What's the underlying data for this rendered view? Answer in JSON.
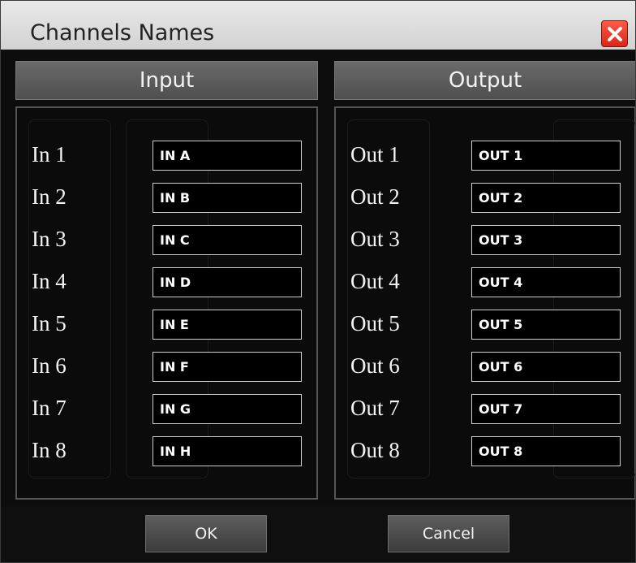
{
  "dialog": {
    "title": "Channels Names",
    "close_icon": "close-icon"
  },
  "input": {
    "header": "Input",
    "rows": [
      {
        "label": "In 1",
        "value": "IN A"
      },
      {
        "label": "In 2",
        "value": "IN B"
      },
      {
        "label": "In 3",
        "value": "IN C"
      },
      {
        "label": "In 4",
        "value": "IN D"
      },
      {
        "label": "In 5",
        "value": "IN E"
      },
      {
        "label": "In 6",
        "value": "IN F"
      },
      {
        "label": "In 7",
        "value": "IN G"
      },
      {
        "label": "In 8",
        "value": "IN H"
      }
    ]
  },
  "output": {
    "header": "Output",
    "rows": [
      {
        "label": "Out 1",
        "value": "OUT 1"
      },
      {
        "label": "Out 2",
        "value": "OUT 2"
      },
      {
        "label": "Out 3",
        "value": "OUT 3"
      },
      {
        "label": "Out 4",
        "value": "OUT 4"
      },
      {
        "label": "Out 5",
        "value": "OUT 5"
      },
      {
        "label": "Out 6",
        "value": "OUT 6"
      },
      {
        "label": "Out 7",
        "value": "OUT 7"
      },
      {
        "label": "Out 8",
        "value": "OUT 8"
      }
    ]
  },
  "buttons": {
    "ok": "OK",
    "cancel": "Cancel"
  },
  "colors": {
    "close_red": "#e0321f",
    "background": "#0d0d0d",
    "header_gray": "#5a5a5a"
  }
}
